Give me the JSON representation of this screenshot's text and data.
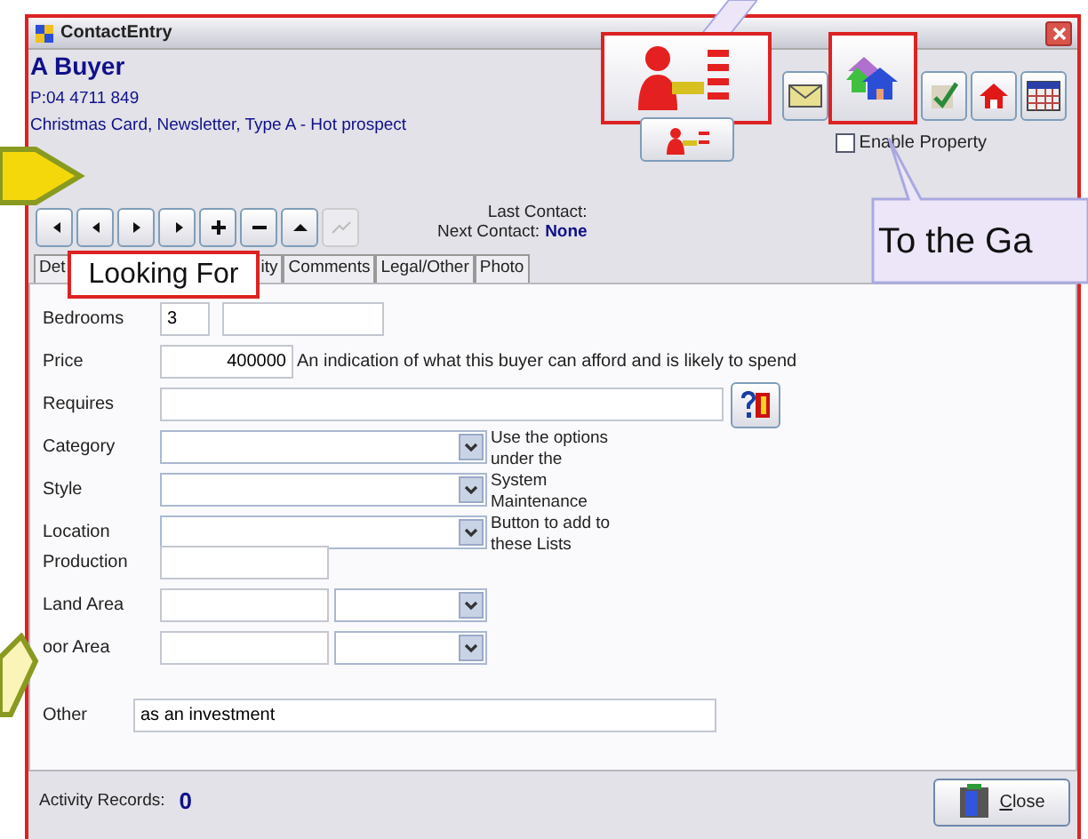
{
  "window": {
    "title": "ContactEntry"
  },
  "contact": {
    "name": "A Buyer",
    "phone": "P:04 4711 849",
    "tags": "Christmas Card, Newsletter, Type A - Hot prospect"
  },
  "enable_property": {
    "label": "Enable Property",
    "checked": false
  },
  "last_contact": {
    "label": "Last Contact:"
  },
  "next_contact": {
    "label": "Next Contact:",
    "value": "None"
  },
  "tabs": [
    {
      "label": "Det",
      "selected": false
    },
    {
      "label": "ity",
      "selected": false
    },
    {
      "label": "Comments",
      "selected": false
    },
    {
      "label": "Legal/Other",
      "selected": false
    },
    {
      "label": "Photo",
      "selected": false
    }
  ],
  "fields": [
    {
      "kind": "pair",
      "label": "Bedrooms",
      "value": "3"
    },
    {
      "kind": "number",
      "label": "Price",
      "value": "400000",
      "note": "An indication of what this buyer can afford and is likely to spend"
    },
    {
      "kind": "lookup",
      "label": "Requires"
    },
    {
      "kind": "select",
      "label": "Category"
    },
    {
      "kind": "select",
      "label": "Style"
    },
    {
      "kind": "select",
      "label": "Location"
    },
    {
      "kind": "text",
      "label": "Production"
    },
    {
      "kind": "area",
      "label": "Land Area"
    },
    {
      "kind": "area",
      "label": "oor Area"
    },
    {
      "kind": "wide",
      "label": "Other",
      "value": "as an investment"
    }
  ],
  "lists_note": "Use the options under the System Maintenance Button to add to these Lists",
  "activity_records": {
    "label": "Activity Records:",
    "value": "0"
  },
  "close_button": {
    "label": "Close"
  },
  "callouts": [
    {
      "text": "Looking For"
    },
    {
      "text": "To the Ga"
    }
  ]
}
